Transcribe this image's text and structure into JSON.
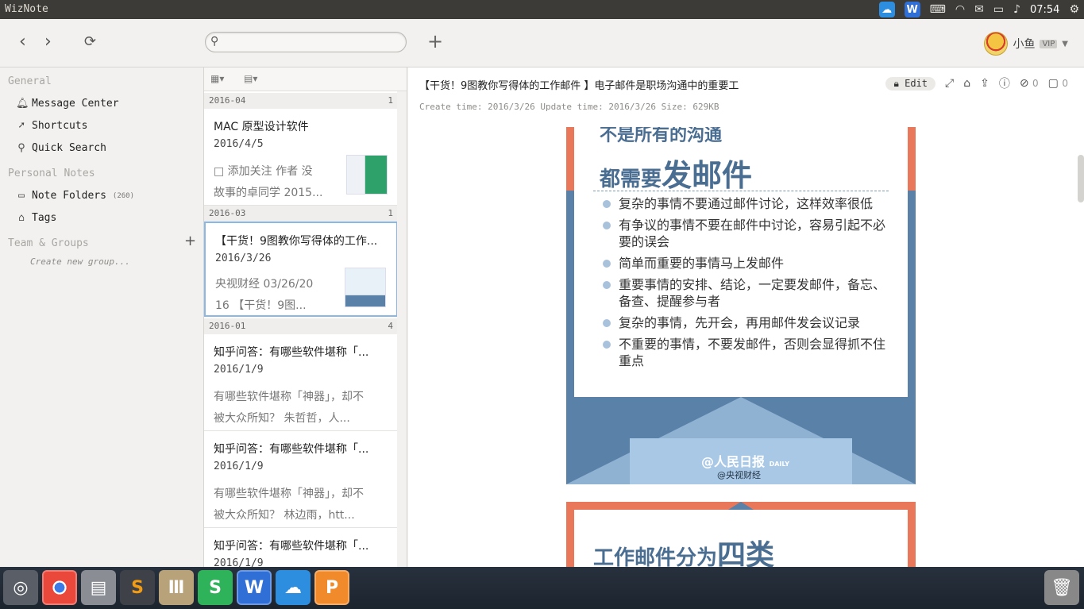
{
  "topbar": {
    "title": "WizNote",
    "clock": "07:54",
    "tray_icons": [
      "baidu-cloud-icon",
      "wps-icon",
      "keyboard-icon",
      "wifi-icon",
      "mail-icon",
      "battery-icon",
      "volume-icon",
      "gear-icon"
    ]
  },
  "toolbar": {
    "search_placeholder": "",
    "user_name": "小鱼",
    "vip_label": "VIP"
  },
  "sidebar": {
    "general_head": "General",
    "message_center": "Message Center",
    "shortcuts": "Shortcuts",
    "quick_search": "Quick Search",
    "personal_head": "Personal Notes",
    "note_folders": "Note Folders",
    "note_folders_count": "(260)",
    "tags": "Tags",
    "team_head": "Team & Groups",
    "create_group": "Create new group..."
  },
  "list": {
    "groups": [
      {
        "date": "2016-04",
        "count": "1"
      },
      {
        "date": "2016-03",
        "count": "1"
      },
      {
        "date": "2016-01",
        "count": "4"
      }
    ],
    "notes": [
      {
        "title": "MAC 原型设计软件",
        "date": "2016/4/5",
        "abstract_1": "□ 添加关注   作者 没",
        "abstract_2": "故事的卓同学 2015..."
      },
      {
        "title": "【干货！9图教你写得体的工作...",
        "date": "2016/3/26",
        "abstract_1": "  央视财经 03/26/20",
        "abstract_2": "16  【干货！9图..."
      },
      {
        "title": "知乎问答：有哪些软件堪称「...",
        "date": "2016/1/9",
        "abstract_1": "有哪些软件堪称「神器」，却不",
        "abstract_2": "被大众所知？ 朱哲哲，人..."
      },
      {
        "title": "知乎问答：有哪些软件堪称「...",
        "date": "2016/1/9",
        "abstract_1": "有哪些软件堪称「神器」，却不",
        "abstract_2": "被大众所知？ 林边雨，htt..."
      },
      {
        "title": "知乎问答：有哪些软件堪称「...",
        "date": "2016/1/9"
      }
    ]
  },
  "document": {
    "title": "【干货！9图教你写得体的工作邮件 】电子邮件是职场沟通中的重要工",
    "meta": "Create time: 2016/3/26  Update time: 2016/3/26  Size: 629KB",
    "edit_label": "Edit",
    "attachments_count": "0",
    "comments_count": "0",
    "poster": {
      "heading_top": "不是所有的沟通",
      "heading_main_prefix": "都需要",
      "heading_main_bold": "发邮件",
      "bullets": [
        "复杂的事情不要通过邮件讨论，这样效率很低",
        "有争议的事情不要在邮件中讨论，容易引起不必要的误会",
        "简单而重要的事情马上发邮件",
        "重要事情的安排、结论，一定要发邮件，备忘、备查、提醒参与者",
        "复杂的事情，先开会，再用邮件发会议记录",
        "不重要的事情，不要发邮件，否则会显得抓不住重点"
      ],
      "logo_text": "@人民日报",
      "logo_sub": "@央视财经",
      "logo_small": "DAILY",
      "next_heading_prefix": "工作邮件分为",
      "next_heading_bold": "四类"
    }
  },
  "colors": {
    "poster_blue": "#5a81a8",
    "poster_orange": "#e9785a",
    "selection_border": "#8ab8e6"
  }
}
